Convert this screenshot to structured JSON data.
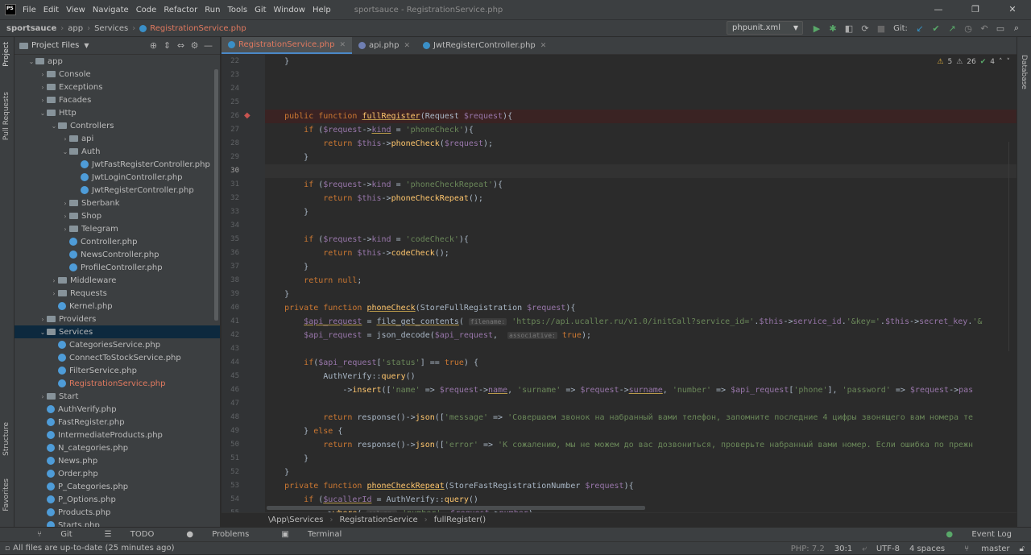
{
  "menubar": {
    "items": [
      "File",
      "Edit",
      "View",
      "Navigate",
      "Code",
      "Refactor",
      "Run",
      "Tools",
      "Git",
      "Window",
      "Help"
    ],
    "title": "sportsauce - RegistrationService.php"
  },
  "navbar": {
    "crumbs": [
      "sportsauce",
      "app",
      "Services",
      "RegistrationService.php"
    ],
    "run_config": "phpunit.xml",
    "git_label": "Git:"
  },
  "project": {
    "title": "Project Files",
    "tree": [
      {
        "label": "app",
        "level": 1,
        "type": "folder",
        "open": true
      },
      {
        "label": "Console",
        "level": 2,
        "type": "folder"
      },
      {
        "label": "Exceptions",
        "level": 2,
        "type": "folder"
      },
      {
        "label": "Facades",
        "level": 2,
        "type": "folder"
      },
      {
        "label": "Http",
        "level": 2,
        "type": "folder",
        "open": true
      },
      {
        "label": "Controllers",
        "level": 3,
        "type": "folder",
        "open": true
      },
      {
        "label": "api",
        "level": 4,
        "type": "folder"
      },
      {
        "label": "Auth",
        "level": 4,
        "type": "folder",
        "open": true
      },
      {
        "label": "JwtFastRegisterController.php",
        "level": 5,
        "type": "php"
      },
      {
        "label": "JwtLoginController.php",
        "level": 5,
        "type": "php"
      },
      {
        "label": "JwtRegisterController.php",
        "level": 5,
        "type": "php"
      },
      {
        "label": "Sberbank",
        "level": 4,
        "type": "folder"
      },
      {
        "label": "Shop",
        "level": 4,
        "type": "folder"
      },
      {
        "label": "Telegram",
        "level": 4,
        "type": "folder"
      },
      {
        "label": "Controller.php",
        "level": 4,
        "type": "php"
      },
      {
        "label": "NewsController.php",
        "level": 4,
        "type": "php"
      },
      {
        "label": "ProfileController.php",
        "level": 4,
        "type": "php"
      },
      {
        "label": "Middleware",
        "level": 3,
        "type": "folder"
      },
      {
        "label": "Requests",
        "level": 3,
        "type": "folder"
      },
      {
        "label": "Kernel.php",
        "level": 3,
        "type": "php"
      },
      {
        "label": "Providers",
        "level": 2,
        "type": "folder"
      },
      {
        "label": "Services",
        "level": 2,
        "type": "folder",
        "open": true,
        "selected": true
      },
      {
        "label": "CategoriesService.php",
        "level": 3,
        "type": "php"
      },
      {
        "label": "ConnectToStockService.php",
        "level": 3,
        "type": "php"
      },
      {
        "label": "FilterService.php",
        "level": 3,
        "type": "php"
      },
      {
        "label": "RegistrationService.php",
        "level": 3,
        "type": "php",
        "red": true
      },
      {
        "label": "Start",
        "level": 2,
        "type": "folder"
      },
      {
        "label": "AuthVerify.php",
        "level": 2,
        "type": "php"
      },
      {
        "label": "FastRegister.php",
        "level": 2,
        "type": "php"
      },
      {
        "label": "IntermediateProducts.php",
        "level": 2,
        "type": "php"
      },
      {
        "label": "N_categories.php",
        "level": 2,
        "type": "php"
      },
      {
        "label": "News.php",
        "level": 2,
        "type": "php"
      },
      {
        "label": "Order.php",
        "level": 2,
        "type": "php"
      },
      {
        "label": "P_Categories.php",
        "level": 2,
        "type": "php"
      },
      {
        "label": "P_Options.php",
        "level": 2,
        "type": "php"
      },
      {
        "label": "Products.php",
        "level": 2,
        "type": "php"
      },
      {
        "label": "Starts.php",
        "level": 2,
        "type": "php"
      }
    ]
  },
  "tabs": [
    {
      "label": "RegistrationService.php",
      "active": true
    },
    {
      "label": "api.php"
    },
    {
      "label": "JwtRegisterController.php"
    }
  ],
  "inspections": {
    "warnings": "5",
    "weak": "26",
    "ok": "4"
  },
  "code_lines": [
    {
      "n": "22",
      "html": "    }"
    },
    {
      "n": "23",
      "html": ""
    },
    {
      "n": "24",
      "html": ""
    },
    {
      "n": "25",
      "html": ""
    },
    {
      "n": "26",
      "html": "    <span class='kw'>public function</span> <span class='fn und'>fullRegister</span>(Request <span class='var'>$request</span>){",
      "bp": true
    },
    {
      "n": "27",
      "html": "        <span class='kw'>if</span> (<span class='var'>$request</span>-><span class='var und'>kind</span> = <span class='str'>'phoneCheck'</span>){"
    },
    {
      "n": "28",
      "html": "            <span class='kw'>return</span> <span class='var'>$this</span>-><span class='fn'>phoneCheck</span>(<span class='var'>$request</span>);"
    },
    {
      "n": "29",
      "html": "        }"
    },
    {
      "n": "30",
      "html": "",
      "cur": true
    },
    {
      "n": "31",
      "html": "        <span class='kw'>if</span> (<span class='var'>$request</span>-><span class='var'>kind</span> = <span class='str'>'phoneCheckRepeat'</span>){"
    },
    {
      "n": "32",
      "html": "            <span class='kw'>return</span> <span class='var'>$this</span>-><span class='fn'>phoneCheckRepeat</span>();"
    },
    {
      "n": "33",
      "html": "        }"
    },
    {
      "n": "34",
      "html": ""
    },
    {
      "n": "35",
      "html": "        <span class='kw'>if</span> (<span class='var'>$request</span>-><span class='var'>kind</span> = <span class='str'>'codeCheck'</span>){"
    },
    {
      "n": "36",
      "html": "            <span class='kw'>return</span> <span class='var'>$this</span>-><span class='fn'>codeCheck</span>();"
    },
    {
      "n": "37",
      "html": "        }"
    },
    {
      "n": "38",
      "html": "        <span class='kw'>return null</span>;"
    },
    {
      "n": "39",
      "html": "    }"
    },
    {
      "n": "40",
      "html": "    <span class='kw'>private function</span> <span class='fn und'>phoneCheck</span>(StoreFullRegistration <span class='var'>$request</span>){"
    },
    {
      "n": "41",
      "html": "        <span class='var und'>$api_request</span> = <span class='und'>file_get_contents</span>( <span class='hint'>filename:</span> <span class='str'>'https://api.ucaller.ru/v1.0/initCall?service_id='</span>.<span class='var'>$this</span>-><span class='var'>service_id</span>.<span class='str'>'&key='</span>.<span class='var'>$this</span>-><span class='var'>secret_key</span>.<span class='str'>'&</span>"
    },
    {
      "n": "42",
      "html": "        <span class='var'>$api_request</span> = json_decode(<span class='var'>$api_request</span>,  <span class='hint'>associative:</span> <span class='kw'>true</span>);"
    },
    {
      "n": "43",
      "html": ""
    },
    {
      "n": "44",
      "html": "        <span class='kw'>if</span>(<span class='var'>$api_request</span>[<span class='str'>'status'</span>] == <span class='kw'>true</span>) {"
    },
    {
      "n": "45",
      "html": "            AuthVerify::<span class='fn'>query</span>()"
    },
    {
      "n": "46",
      "html": "                -><span class='fn'>insert</span>([<span class='str'>'name'</span> => <span class='var'>$request</span>-><span class='var und'>name</span>, <span class='str'>'surname'</span> => <span class='var'>$request</span>-><span class='var und'>surname</span>, <span class='str'>'number'</span> => <span class='var'>$api_request</span>[<span class='str'>'phone'</span>], <span class='str'>'password'</span> => <span class='var'>$request</span>-><span class='var'>pas</span>"
    },
    {
      "n": "47",
      "html": ""
    },
    {
      "n": "48",
      "html": "            <span class='kw'>return</span> response()-><span class='fn'>json</span>([<span class='str'>'message'</span> => <span class='str'>'Совершаем звонок на набранный вами телефон, запомните последние 4 цифры звонящего вам номера те</span>"
    },
    {
      "n": "49",
      "html": "        } <span class='kw'>else</span> {"
    },
    {
      "n": "50",
      "html": "            <span class='kw'>return</span> response()-><span class='fn'>json</span>([<span class='str'>'error'</span> => <span class='str'>'К сожалению, мы не можем до вас дозвониться, проверьте набранный вами номер. Если ошибка по прежн</span>"
    },
    {
      "n": "51",
      "html": "        }"
    },
    {
      "n": "52",
      "html": "    }"
    },
    {
      "n": "53",
      "html": "    <span class='kw'>private function</span> <span class='fn und'>phoneCheckRepeat</span>(StoreFastRegistrationNumber <span class='var'>$request</span>){"
    },
    {
      "n": "54",
      "html": "        <span class='kw'>if</span> (<span class='var und'>$ucallerId</span> = AuthVerify::<span class='fn'>query</span>()"
    },
    {
      "n": "55",
      "html": "            -><span class='fn'>where</span>( <span class='hint'>column:</span> <span class='str'>'number'</span>, <span class='var'>$request</span>-><span class='var'>number</span>)"
    }
  ],
  "editor_crumbs": [
    "\\App\\Services",
    "RegistrationService",
    "fullRegister()"
  ],
  "toolbar": [
    "Git",
    "TODO",
    "Problems",
    "Terminal"
  ],
  "event_log": "Event Log",
  "left_strip": [
    "Project",
    "Pull Requests",
    "Structure",
    "Favorites"
  ],
  "right_strip": [
    "Database"
  ],
  "status": {
    "message": "All files are up-to-date (25 minutes ago)",
    "php": "PHP: 7.2",
    "pos": "30:1",
    "encoding": "UTF-8",
    "indent": "4 spaces",
    "branch": "master"
  }
}
